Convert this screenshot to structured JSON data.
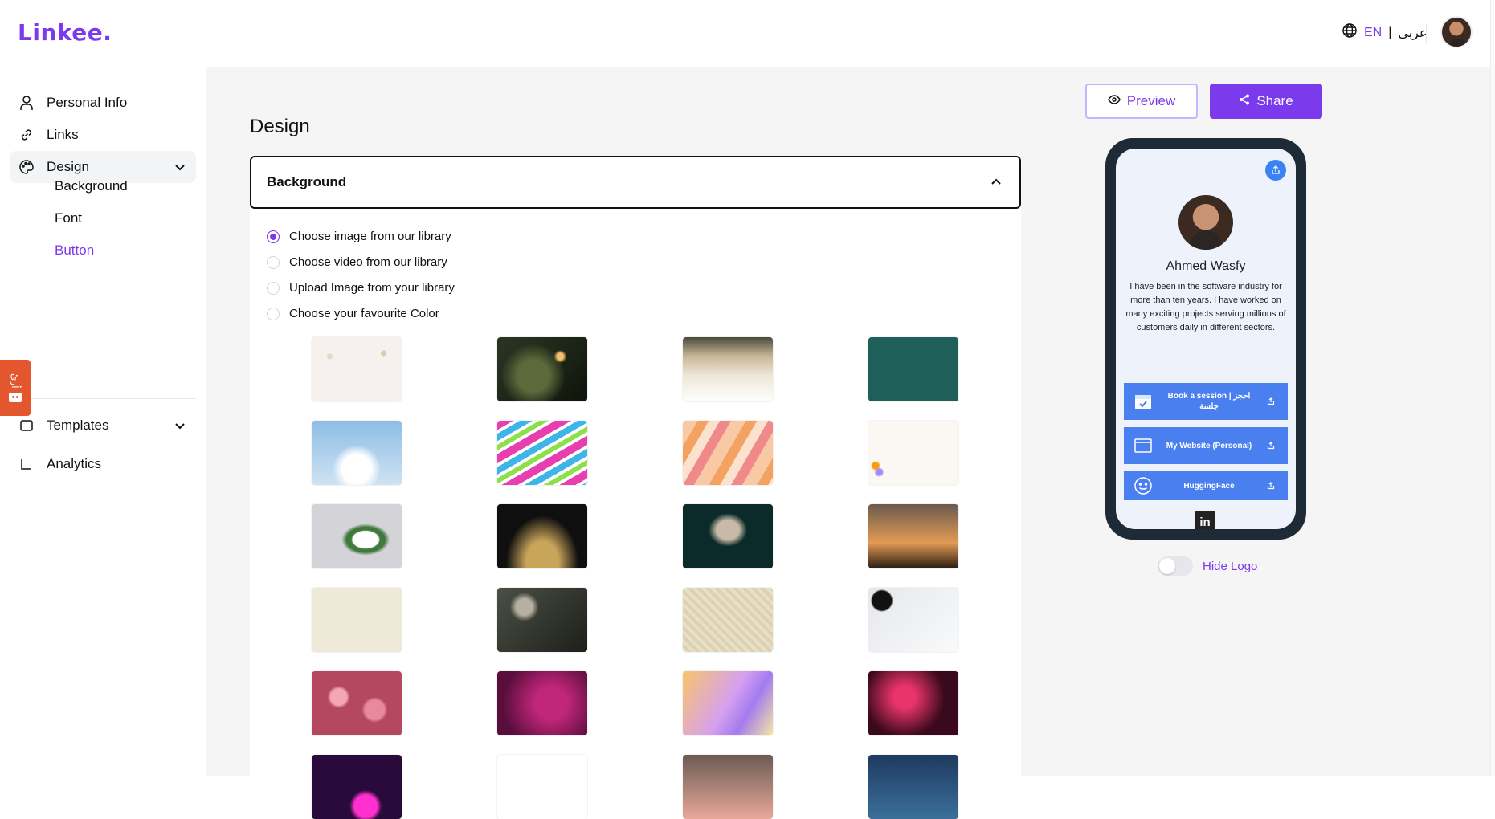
{
  "app": {
    "logo": "Linkee."
  },
  "header": {
    "lang_en": "EN",
    "lang_sep": "|",
    "lang_ar": "عربى"
  },
  "sidebar": {
    "personal_info": "Personal Info",
    "links": "Links",
    "design": "Design",
    "design_sub": {
      "background": "Background",
      "font": "Font",
      "button": "Button"
    },
    "templates": "Templates",
    "analytics": "Analytics"
  },
  "float_tab": {
    "label": "ﺃﺭﺉ"
  },
  "main": {
    "title": "Design",
    "accordion_title": "Background",
    "options": [
      {
        "label": "Choose image from our library",
        "selected": true
      },
      {
        "label": "Choose video from our library",
        "selected": false
      },
      {
        "label": "Upload Image from your library",
        "selected": false
      },
      {
        "label": "Choose your favourite Color",
        "selected": false
      }
    ],
    "thumbnails": [
      "cream-ornaments",
      "pine-bokeh",
      "christmas-stars",
      "teal-green",
      "cherry-blossom",
      "colorful-brushstrokes",
      "peach-waves",
      "white-feathers",
      "white-tulips",
      "gold-glitter-dark",
      "mosque-window",
      "lantern-sunset",
      "beige-islamic",
      "dome-arches",
      "beige-pattern",
      "phone-coffee",
      "pink-daisies",
      "magenta-smoke",
      "purple-yellow-gradient",
      "red-dark-smoke",
      "neon-circle",
      "line-flower",
      "sunset-sea",
      "ocean-wave"
    ]
  },
  "actions": {
    "preview": "Preview",
    "share": "Share"
  },
  "phone": {
    "name": "Ahmed Wasfy",
    "bio": "I have been in the software industry for more than ten years. I have worked on many exciting projects serving millions of customers daily in different sectors.",
    "links": [
      {
        "label": "Book a session | احجز جلسة",
        "icon": "calendar-check-icon"
      },
      {
        "label": "My Website (Personal)",
        "icon": "browser-window-icon"
      },
      {
        "label": "HuggingFace",
        "icon": "smiley-icon"
      }
    ],
    "social": "in"
  },
  "hide_logo": {
    "label": "Hide Logo",
    "on": false
  },
  "colors": {
    "accent": "#7c3aed",
    "link_blue": "#4a7ff0",
    "phone_frame": "#1f2a37"
  }
}
